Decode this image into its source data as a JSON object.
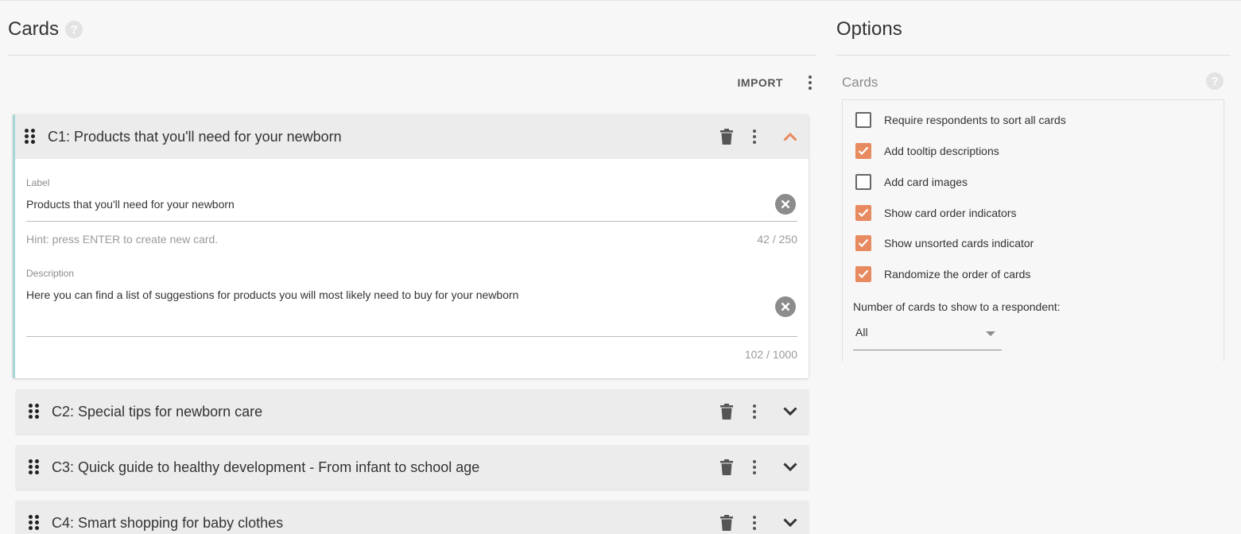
{
  "cards_panel": {
    "title": "Cards",
    "import_label": "IMPORT",
    "cards": [
      {
        "title": "C1: Products that you'll need for your newborn",
        "expanded": true,
        "label_caption": "Label",
        "label_value": "Products that you'll need for your newborn",
        "hint": "Hint: press ENTER to create new card.",
        "label_counter": "42 / 250",
        "description_caption": "Description",
        "description_value": "Here you can find a list of suggestions for products you will most likely need to buy for your newborn",
        "description_counter": "102 / 1000"
      },
      {
        "title": "C2: Special tips for newborn care",
        "expanded": false
      },
      {
        "title": "C3: Quick guide to healthy development - From infant to school age",
        "expanded": false
      },
      {
        "title": "C4: Smart shopping for baby clothes",
        "expanded": false
      }
    ]
  },
  "options_panel": {
    "title": "Options",
    "section_title": "Cards",
    "options": [
      {
        "label": "Require respondents to sort all cards",
        "checked": false
      },
      {
        "label": "Add tooltip descriptions",
        "checked": true
      },
      {
        "label": "Add card images",
        "checked": false
      },
      {
        "label": "Show card order indicators",
        "checked": true
      },
      {
        "label": "Show unsorted cards indicator",
        "checked": true
      },
      {
        "label": "Randomize the order of cards",
        "checked": true
      }
    ],
    "num_cards_label": "Number of cards to show to a respondent:",
    "num_cards_value": "All"
  },
  "colors": {
    "accent": "#e88a60",
    "expanded_border": "#a8d5d6",
    "card_header_bg": "#ececec"
  },
  "icons": {
    "help": "help-icon",
    "more": "more-vert-icon",
    "drag": "drag-handle-icon",
    "delete": "trash-icon",
    "collapse": "chevron-up-icon",
    "expand": "chevron-down-icon",
    "clear": "clear-icon",
    "check": "check-icon",
    "dropdown": "caret-down-icon"
  }
}
